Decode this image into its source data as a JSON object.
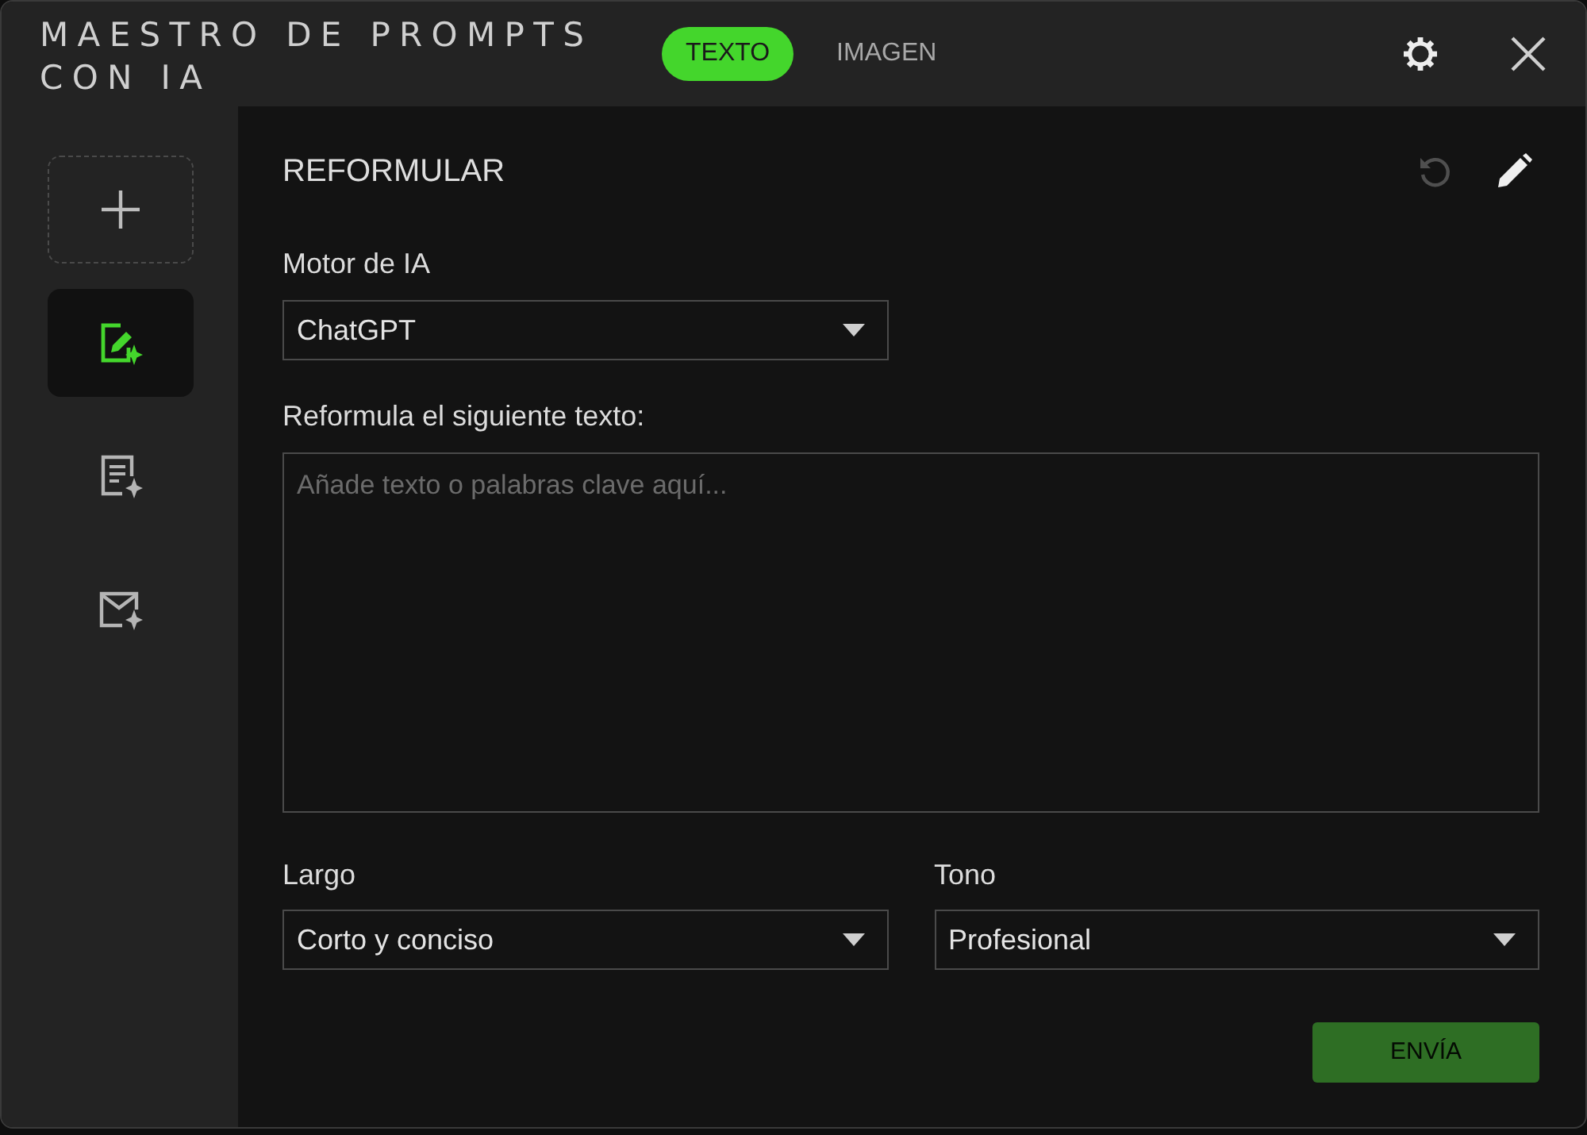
{
  "window": {
    "title": "MAESTRO DE PROMPTS CON IA"
  },
  "tabs": [
    {
      "label": "TEXTO",
      "selected": true
    },
    {
      "label": "IMAGEN",
      "selected": false
    }
  ],
  "sidebar": {
    "items": [
      {
        "kind": "add",
        "selected": false
      },
      {
        "kind": "rewrite",
        "selected": true
      },
      {
        "kind": "document",
        "selected": false
      },
      {
        "kind": "email",
        "selected": false
      }
    ]
  },
  "panel": {
    "title": "REFORMULAR",
    "toolbar": [
      {
        "kind": "undo",
        "disabled": true
      },
      {
        "kind": "edit",
        "disabled": false
      }
    ],
    "engine": {
      "label": "Motor de IA",
      "value": "ChatGPT"
    },
    "prompt": {
      "label": "Reformula el siguiente texto:",
      "placeholder": "Añade texto o palabras clave aquí..."
    },
    "length": {
      "label": "Largo",
      "value": "Corto y conciso"
    },
    "tone": {
      "label": "Tono",
      "value": "Profesional"
    },
    "submit": {
      "label": "ENVÍA",
      "disabled": true
    }
  }
}
